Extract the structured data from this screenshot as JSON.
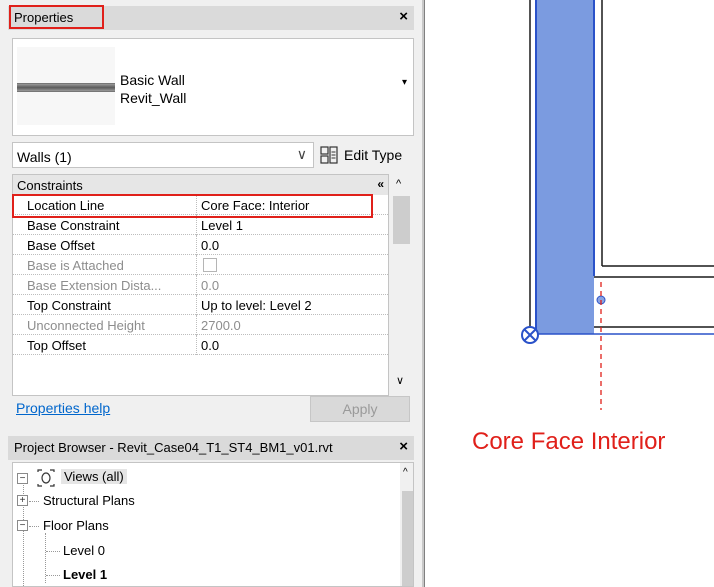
{
  "properties": {
    "title": "Properties",
    "close": "×",
    "type_family": "Basic Wall",
    "type_name": "Revit_Wall",
    "type_caret": "▾",
    "instance_label": "Walls (1)",
    "instance_chevron": "∨",
    "edit_type": "Edit Type",
    "group": "Constraints",
    "group_collapse": "«",
    "rows": [
      {
        "key": "Location Line",
        "value": "Core Face: Interior"
      },
      {
        "key": "Base Constraint",
        "value": "Level 1"
      },
      {
        "key": "Base Offset",
        "value": "0.0"
      },
      {
        "key": "Base is Attached",
        "value": ""
      },
      {
        "key": "Base Extension Dista...",
        "value": "0.0"
      },
      {
        "key": "Top Constraint",
        "value": "Up to level: Level 2"
      },
      {
        "key": "Unconnected Height",
        "value": "2700.0"
      },
      {
        "key": "Top Offset",
        "value": "0.0"
      }
    ],
    "help_link": "Properties help",
    "apply": "Apply",
    "scroll_up": "^",
    "scroll_down": "∨"
  },
  "browser": {
    "title": "Project Browser - Revit_Case04_T1_ST4_BM1_v01.rvt",
    "close": "×",
    "tree": {
      "root": "Views (all)",
      "root_toggle": "−",
      "structural_plans": "Structural Plans",
      "structural_toggle": "+",
      "floor_plans": "Floor Plans",
      "floor_toggle": "−",
      "level0": "Level 0",
      "level1": "Level 1"
    },
    "scroll_up": "^"
  },
  "canvas": {
    "caption": "Core Face Interior",
    "colors": {
      "wall_fill": "#7b9be0",
      "wall_edge": "#2a52c9",
      "red": "#e0201a"
    }
  }
}
